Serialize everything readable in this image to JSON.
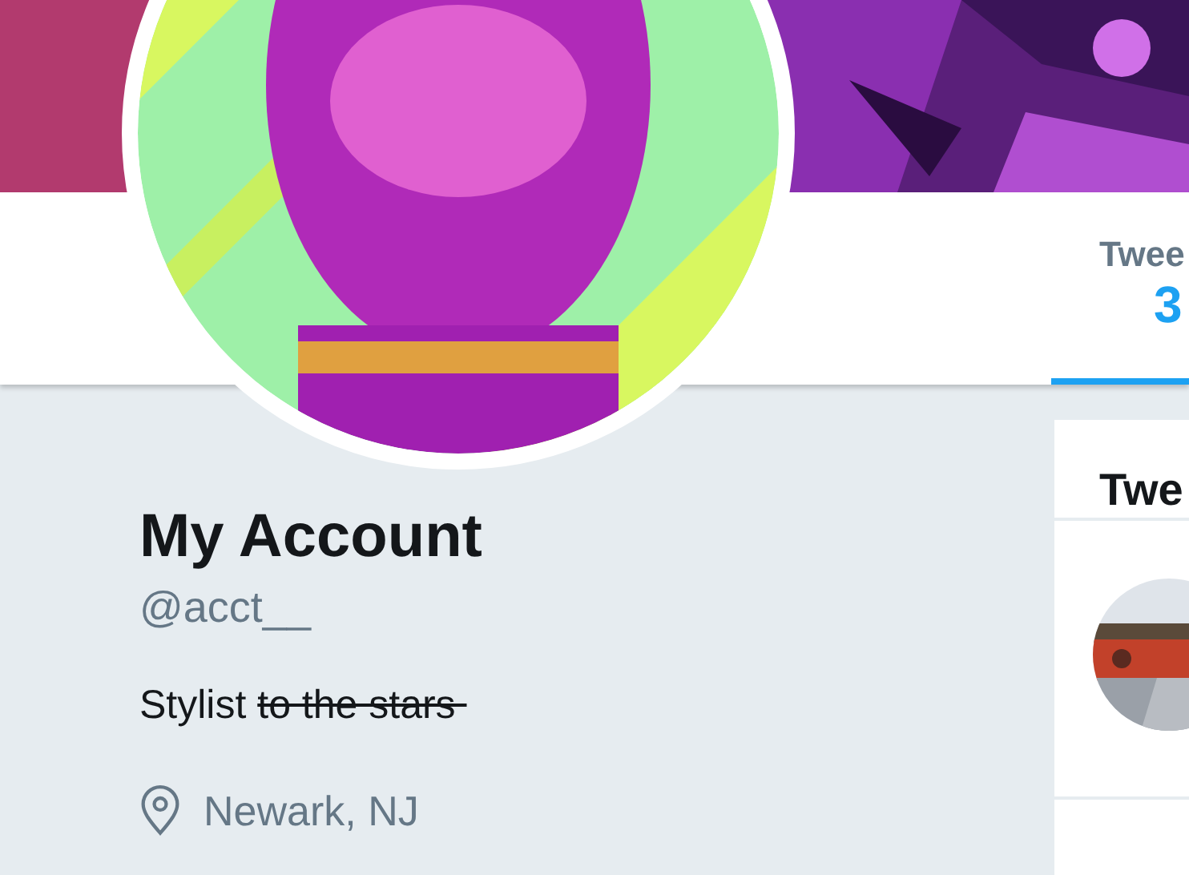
{
  "nav": {
    "tabs": [
      {
        "label": "Twee",
        "count": "3",
        "selected": true
      }
    ]
  },
  "profile": {
    "name": "My Account",
    "handle": "@acct__",
    "bio": [
      {
        "text": "Stylist ",
        "struck": false
      },
      {
        "text": "to the stars ",
        "struck": true
      }
    ],
    "location": "Newark, NJ"
  },
  "timeline": {
    "title": "Twe"
  }
}
